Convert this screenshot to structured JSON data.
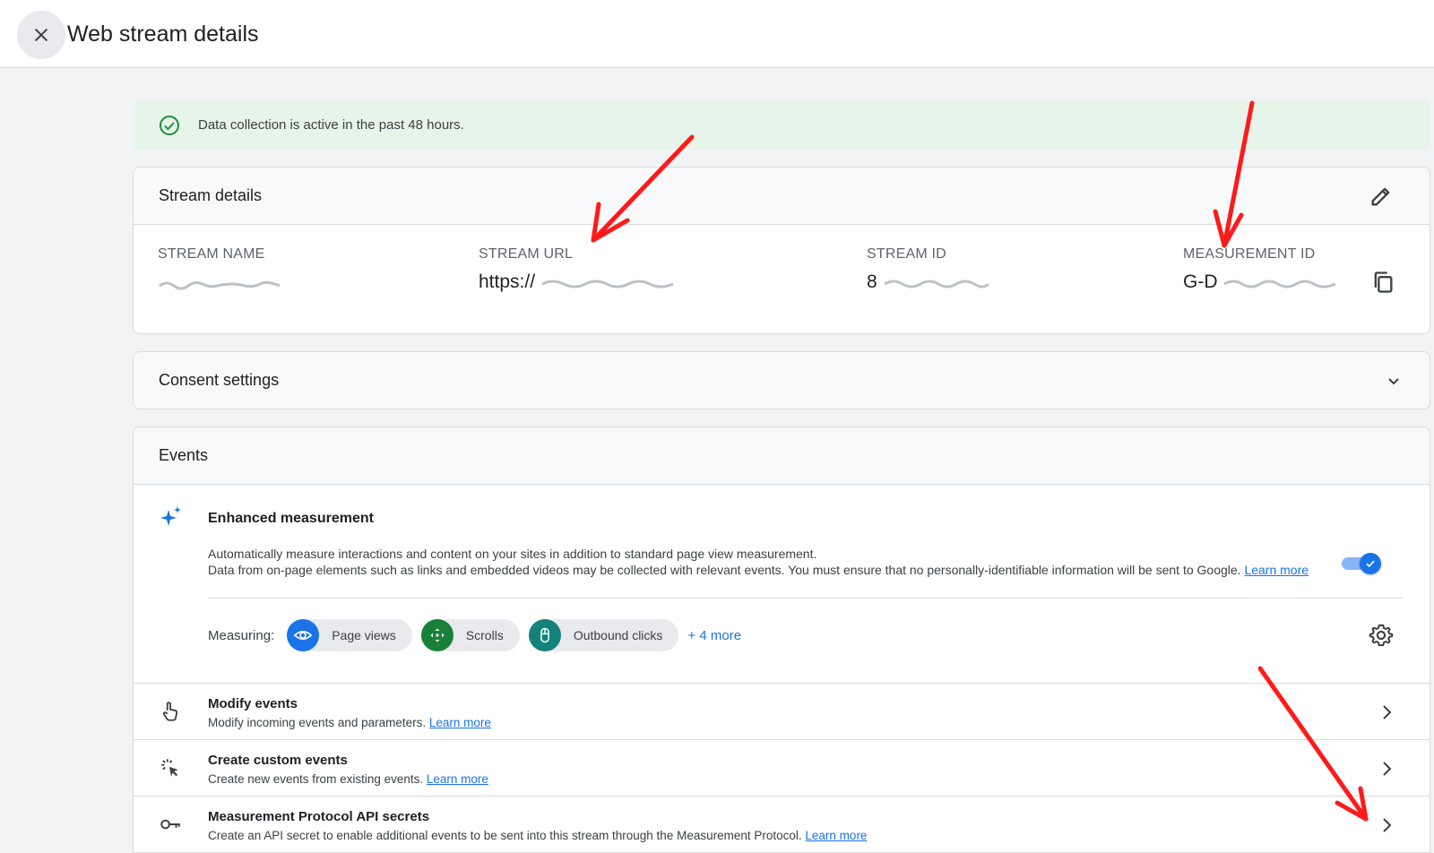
{
  "header": {
    "title": "Web stream details"
  },
  "banner": {
    "text": "Data collection is active in the past 48 hours.",
    "color": "#1e8e3e"
  },
  "stream_details": {
    "title": "Stream details",
    "fields": [
      {
        "label": "STREAM NAME",
        "value": ""
      },
      {
        "label": "STREAM URL",
        "value": "https://"
      },
      {
        "label": "STREAM ID",
        "value": "8"
      },
      {
        "label": "MEASUREMENT ID",
        "value": "G-D"
      }
    ]
  },
  "consent": {
    "title": "Consent settings"
  },
  "events": {
    "title": "Events",
    "enhanced": {
      "title": "Enhanced measurement",
      "desc1": "Automatically measure interactions and content on your sites in addition to standard page view measurement.",
      "desc2": "Data from on-page elements such as links and embedded videos may be collected with relevant events. You must ensure that no personally-identifiable information will be sent to Google.",
      "learn_more": "Learn more",
      "toggle_on": true,
      "measuring_label": "Measuring:",
      "chips": [
        {
          "label": "Page views",
          "icon": "eye-icon",
          "color": "#1a73e8"
        },
        {
          "label": "Scrolls",
          "icon": "scroll-icon",
          "color": "#188038"
        },
        {
          "label": "Outbound clicks",
          "icon": "mouse-icon",
          "color": "#12827a"
        }
      ],
      "more": "+ 4 more"
    },
    "rows": [
      {
        "title": "Modify events",
        "desc": "Modify incoming events and parameters.",
        "link": "Learn more",
        "icon": "touch-icon"
      },
      {
        "title": "Create custom events",
        "desc": "Create new events from existing events.",
        "link": "Learn more",
        "icon": "click-sparkle-icon"
      },
      {
        "title": "Measurement Protocol API secrets",
        "desc": "Create an API secret to enable additional events to be sent into this stream through the Measurement Protocol.",
        "link": "Learn more",
        "icon": "key-icon"
      }
    ]
  },
  "colors": {
    "accent": "#1a73e8",
    "annotation_arrow": "#ff1a1a"
  }
}
